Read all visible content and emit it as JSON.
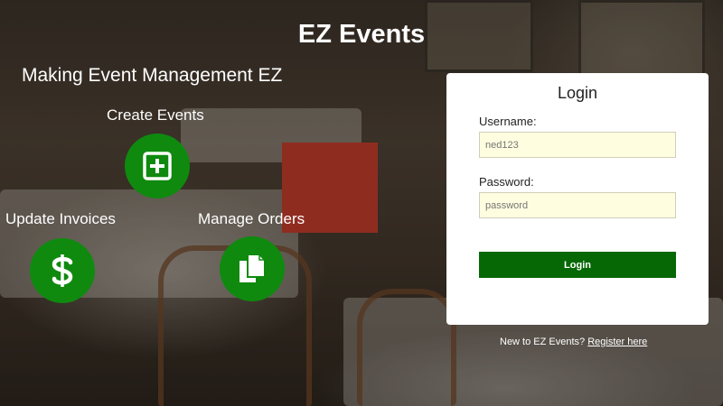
{
  "app": {
    "title": "EZ Events",
    "tagline": "Making Event Management EZ"
  },
  "features": [
    {
      "label": "Create Events",
      "icon": "plus-square-icon"
    },
    {
      "label": "Update Invoices",
      "icon": "dollar-icon"
    },
    {
      "label": "Manage Orders",
      "icon": "copy-documents-icon"
    }
  ],
  "login": {
    "title": "Login",
    "username_label": "Username:",
    "username_placeholder": "ned123",
    "password_label": "Password:",
    "password_placeholder": "password",
    "button_label": "Login"
  },
  "register": {
    "prompt": "New to EZ Events? ",
    "link_label": "Register here"
  },
  "colors": {
    "feature_button": "#0f8a0f",
    "login_button": "#056805",
    "input_background": "#fffde0"
  }
}
